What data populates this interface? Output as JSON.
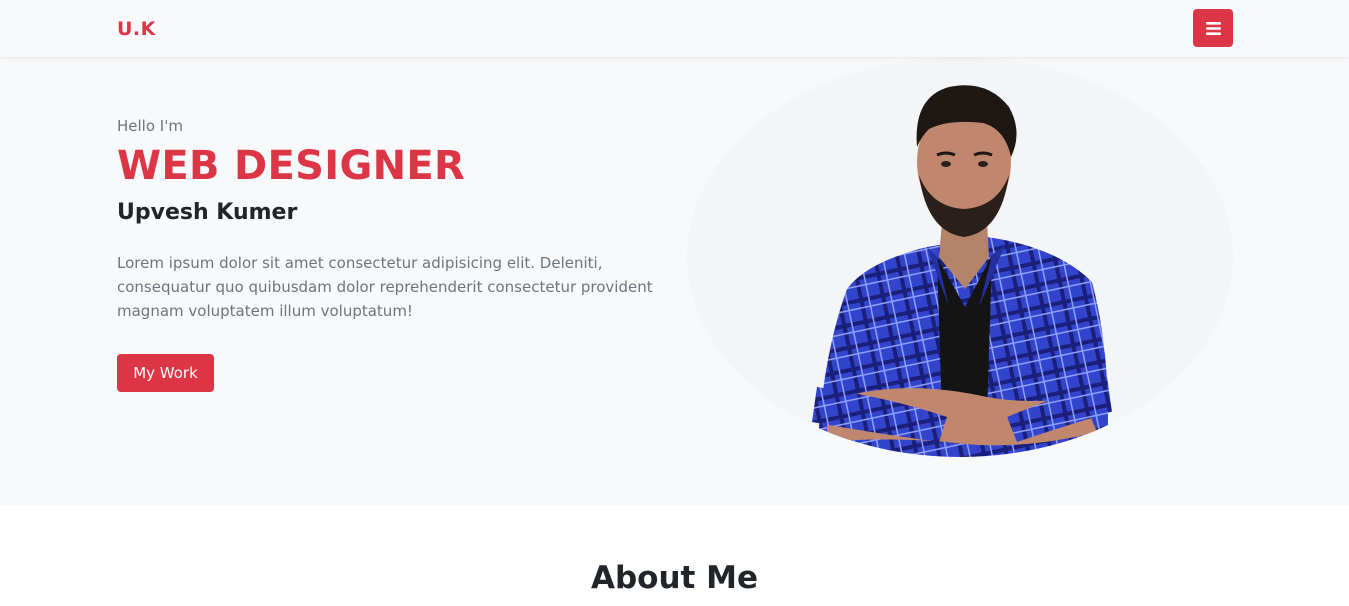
{
  "navbar": {
    "brand": "U.K",
    "menu_icon": "hamburger-menu-icon"
  },
  "hero": {
    "greeting": "Hello I'm",
    "role": "WEB DESIGNER",
    "name": "Upvesh Kumer",
    "description": "Lorem ipsum dolor sit amet consectetur adipisicing elit. Deleniti, consequatur quo quibusdam dolor reprehenderit consectetur provident magnam voluptatem illum voluptatum!",
    "cta_label": "My Work",
    "portrait": "man-portrait-blue-plaid-shirt"
  },
  "about": {
    "title": "About Me"
  },
  "colors": {
    "accent": "#dc3545",
    "hero_bg": "#f8f9fa",
    "muted_text": "#6c757d",
    "dark_text": "#212529",
    "shirt_blue": "#3344cc"
  }
}
